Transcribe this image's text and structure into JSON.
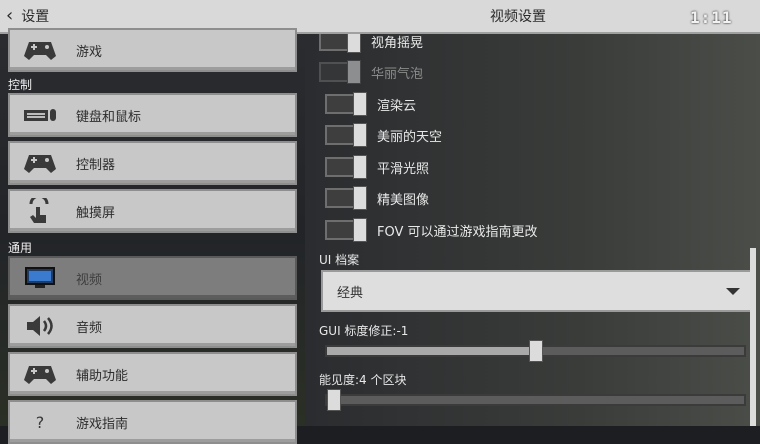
{
  "header": {
    "back_label": "设置",
    "title": "视频设置",
    "clock": "1:11",
    "back_icon": "chevron-left-icon"
  },
  "sidebar": {
    "sections": {
      "controls": "控制",
      "general": "通用"
    },
    "items": [
      {
        "label": "游戏",
        "icon": "controller-icon"
      },
      {
        "label": "键盘和鼠标",
        "icon": "keyboard-mouse-icon"
      },
      {
        "label": "控制器",
        "icon": "controller-icon"
      },
      {
        "label": "触摸屏",
        "icon": "touch-hand-icon"
      },
      {
        "label": "视频",
        "icon": "monitor-icon",
        "active": true
      },
      {
        "label": "音频",
        "icon": "speaker-icon"
      },
      {
        "label": "辅助功能",
        "icon": "controller-icon"
      },
      {
        "label": "游戏指南",
        "icon": "question-icon"
      }
    ]
  },
  "video": {
    "toggles": [
      {
        "label": "视角摇晃",
        "on": true,
        "disabled": false
      },
      {
        "label": "华丽气泡",
        "on": true,
        "disabled": true
      },
      {
        "label": "渲染云",
        "on": true,
        "disabled": false
      },
      {
        "label": "美丽的天空",
        "on": true,
        "disabled": false
      },
      {
        "label": "平滑光照",
        "on": true,
        "disabled": false
      },
      {
        "label": "精美图像",
        "on": true,
        "disabled": false
      },
      {
        "label": "FOV 可以通过游戏指南更改",
        "on": true,
        "disabled": false
      }
    ],
    "ui_profile": {
      "label": "UI 档案",
      "value": "经典"
    },
    "gui_scale": {
      "label": "GUI 标度修正:-1",
      "fraction": 0.5
    },
    "render_distance": {
      "label": "能见度:4 个区块",
      "fraction": 0.0
    }
  },
  "colors": {
    "topbar": "#d9d9d9",
    "active_item": "#7d7d7d",
    "item": "#c8c8c8"
  }
}
